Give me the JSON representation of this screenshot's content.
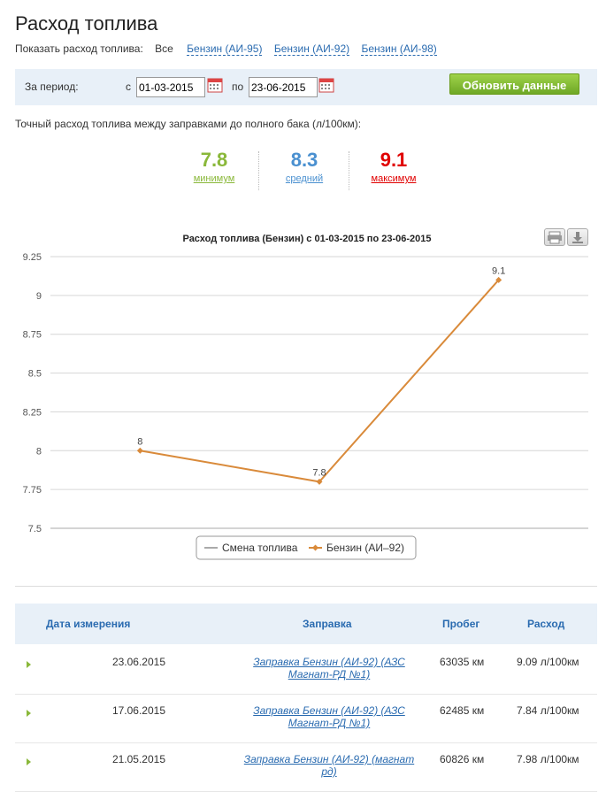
{
  "page": {
    "title": "Расход топлива"
  },
  "filters": {
    "label": "Показать расход топлива:",
    "all": "Все",
    "links": [
      "Бензин (АИ-95)",
      "Бензин (АИ-92)",
      "Бензин (АИ-98)"
    ]
  },
  "period": {
    "label": "За период:",
    "from_label": "с",
    "from_value": "01-03-2015",
    "to_label": "по",
    "to_value": "23-06-2015",
    "refresh_label": "Обновить данные"
  },
  "summary": {
    "caption": "Точный расход топлива между заправками до полного бака (л/100км):",
    "stats": [
      {
        "value": "7.8",
        "label": "минимум",
        "color": "#8ab83a"
      },
      {
        "value": "8.3",
        "label": "средний",
        "color": "#4a90d0"
      },
      {
        "value": "9.1",
        "label": "максимум",
        "color": "#e00000"
      }
    ]
  },
  "chart_data": {
    "type": "line",
    "title": "Расход топлива (Бензин) с 01-03-2015 по 23-06-2015",
    "ylim": [
      7.5,
      9.25
    ],
    "yticks": [
      "7.5",
      "7.75",
      "8",
      "8.25",
      "8.5",
      "8.75",
      "9",
      "9.25"
    ],
    "grid": true,
    "legend_position": "bottom",
    "series": [
      {
        "name": "Смена топлива",
        "values": [],
        "color": "#aaaaaa"
      },
      {
        "name": "Бензин (АИ–92)",
        "values": [
          8,
          7.8,
          9.1
        ],
        "data_labels": [
          "8",
          "7.8",
          "9.1"
        ],
        "color": "#d98a3a"
      }
    ]
  },
  "table": {
    "headers": [
      "Дата измерения",
      "Заправка",
      "Пробег",
      "Расход"
    ],
    "rows": [
      {
        "date": "23.06.2015",
        "station": "Заправка Бензин (АИ-92) (АЗС Магнат-РД №1)",
        "mileage": "63035 км",
        "consumption": "9.09 л/100км"
      },
      {
        "date": "17.06.2015",
        "station": "Заправка Бензин (АИ-92) (АЗС Магнат-РД №1)",
        "mileage": "62485 км",
        "consumption": "7.84 л/100км"
      },
      {
        "date": "21.05.2015",
        "station": "Заправка Бензин (АИ-92) (магнат рд)",
        "mileage": "60826 км",
        "consumption": "7.98 л/100км"
      }
    ]
  }
}
